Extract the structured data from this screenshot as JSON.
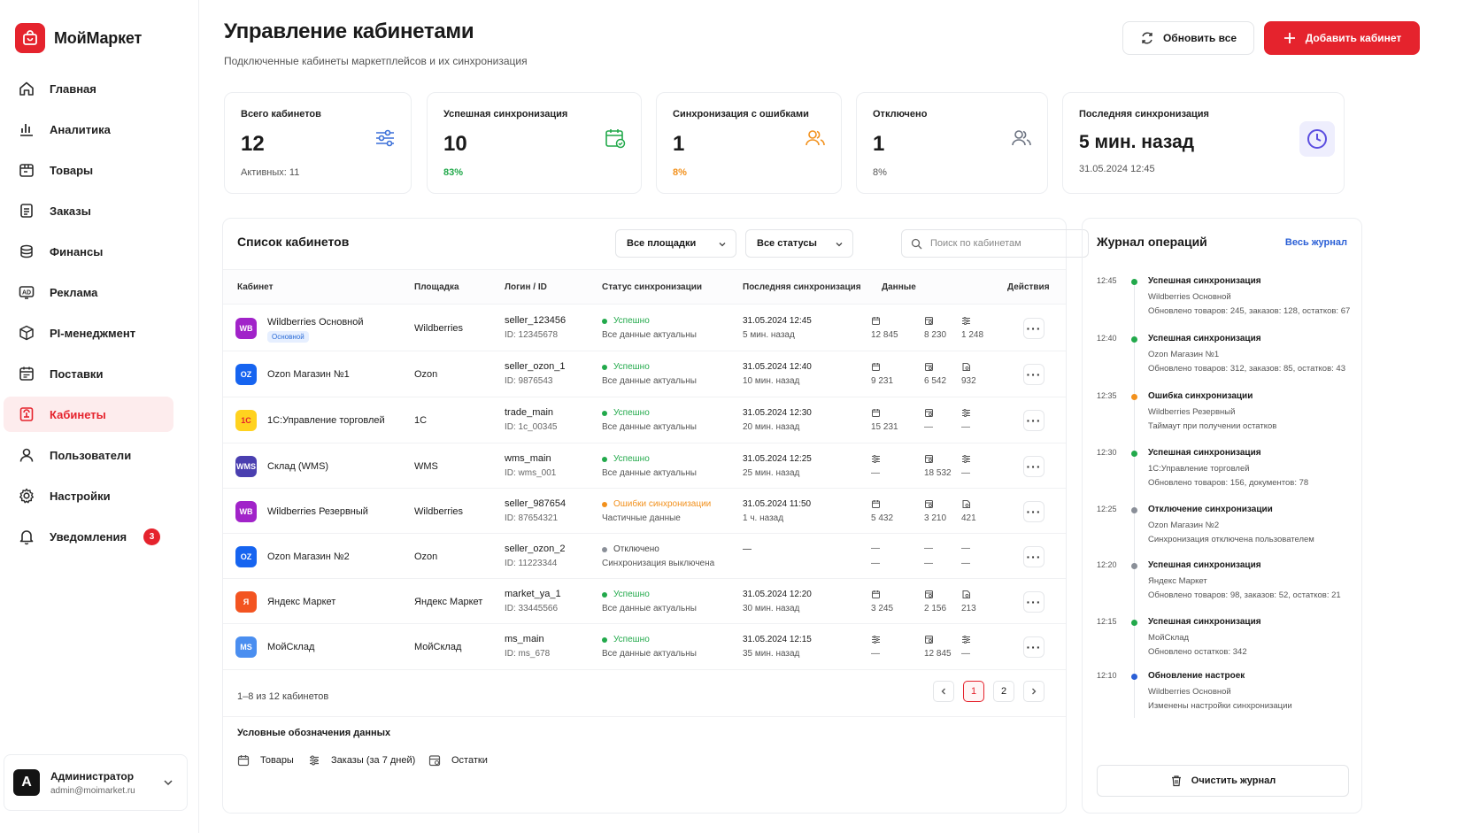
{
  "app": {
    "name": "МойМаркет"
  },
  "nav": [
    {
      "label": "Главная",
      "icon": "home-icon"
    },
    {
      "label": "Аналитика",
      "icon": "bar-chart-icon"
    },
    {
      "label": "Товары",
      "icon": "box-icon"
    },
    {
      "label": "Заказы",
      "icon": "clipboard-icon"
    },
    {
      "label": "Финансы",
      "icon": "coins-icon"
    },
    {
      "label": "Реклама",
      "icon": "ad-icon"
    },
    {
      "label": "PI-менеджмент",
      "icon": "cube-icon"
    },
    {
      "label": "Поставки",
      "icon": "calendar-icon"
    },
    {
      "label": "Кабинеты",
      "icon": "cabinet-icon",
      "active": true
    },
    {
      "label": "Пользователи",
      "icon": "user-icon"
    },
    {
      "label": "Настройки",
      "icon": "gear-icon"
    },
    {
      "label": "Уведомления",
      "icon": "bell-icon",
      "badge": "3"
    }
  ],
  "user": {
    "initial": "A",
    "name": "Администратор",
    "email": "admin@moimarket.ru"
  },
  "header": {
    "title": "Управление кабинетами",
    "subtitle": "Подключенные кабинеты маркетплейсов и их синхронизация",
    "refresh_label": "Обновить все",
    "add_label": "Добавить кабинет"
  },
  "stats": [
    {
      "label": "Всего кабинетов",
      "value": "12",
      "sub": "Активных: 11",
      "icon": "sliders-icon"
    },
    {
      "label": "Успешная синхронизация",
      "value": "10",
      "sub": "83%",
      "icon": "calendar-check-icon"
    },
    {
      "label": "Синхронизация с ошибками",
      "value": "1",
      "sub": "8%",
      "icon": "users-icon"
    },
    {
      "label": "Отключено",
      "value": "1",
      "sub": "8%",
      "icon": "users-icon"
    },
    {
      "label": "Последняя синхронизация",
      "value": "5 мин. назад",
      "sub": "31.05.2024 12:45",
      "icon": "clock-icon"
    }
  ],
  "list": {
    "title": "Список кабинетов",
    "filter_platform": "Все площадки",
    "filter_status": "Все статусы",
    "search_placeholder": "Поиск по кабинетам",
    "columns": [
      "Кабинет",
      "Площадка",
      "Логин / ID",
      "Статус синхронизации",
      "Последняя синхронизация",
      "Данные",
      "Действия"
    ],
    "rows": [
      {
        "logo": "WB",
        "name": "Wildberries Основной",
        "tag": "Основной",
        "platform": "Wildberries",
        "login": "seller_123456",
        "id": "ID: 12345678",
        "status": "Успешно",
        "status_desc": "Все данные актуальны",
        "date": "31.05.2024 12:45",
        "ago": "5 мин. назад",
        "d": [
          "12 845",
          "8 230",
          "1 248"
        ],
        "di": [
          "calendar",
          "box",
          "list"
        ]
      },
      {
        "logo": "OZ",
        "name": "Ozon Магазин №1",
        "tag": "",
        "platform": "Ozon",
        "login": "seller_ozon_1",
        "id": "ID: 9876543",
        "status": "Успешно",
        "status_desc": "Все данные актуальны",
        "date": "31.05.2024 12:40",
        "ago": "10 мин. назад",
        "d": [
          "9 231",
          "6 542",
          "932"
        ],
        "di": [
          "calendar",
          "box",
          "doc"
        ]
      },
      {
        "logo": "1С",
        "name": "1С:Управление торговлей",
        "tag": "",
        "platform": "1С",
        "login": "trade_main",
        "id": "ID: 1c_00345",
        "status": "Успешно",
        "status_desc": "Все данные актуальны",
        "date": "31.05.2024 12:30",
        "ago": "20 мин. назад",
        "d": [
          "15 231",
          "—",
          "—"
        ],
        "di": [
          "calendar",
          "box",
          "list"
        ]
      },
      {
        "logo": "WMS",
        "name": "Склад (WMS)",
        "tag": "",
        "platform": "WMS",
        "login": "wms_main",
        "id": "ID: wms_001",
        "status": "Успешно",
        "status_desc": "Все данные актуальны",
        "date": "31.05.2024 12:25",
        "ago": "25 мин. назад",
        "d": [
          "—",
          "18 532",
          "—"
        ],
        "di": [
          "list",
          "box",
          "list"
        ]
      },
      {
        "logo": "WB",
        "name": "Wildberries Резервный",
        "tag": "",
        "platform": "Wildberries",
        "login": "seller_987654",
        "id": "ID: 87654321",
        "status": "Ошибки синхронизации",
        "status_desc": "Частичные данные",
        "date": "31.05.2024 11:50",
        "ago": "1 ч. назад",
        "d": [
          "5 432",
          "3 210",
          "421"
        ],
        "di": [
          "calendar",
          "box",
          "doc"
        ]
      },
      {
        "logo": "OZ",
        "name": "Ozon Магазин №2",
        "tag": "",
        "platform": "Ozon",
        "login": "seller_ozon_2",
        "id": "ID: 11223344",
        "status": "Отключено",
        "status_desc": "Синхронизация выключена",
        "date": "—",
        "ago": "",
        "d": [
          "—",
          "—",
          "—"
        ],
        "di": [
          "",
          "",
          ""
        ]
      },
      {
        "logo": "Я",
        "name": "Яндекс Маркет",
        "tag": "",
        "platform": "Яндекс Маркет",
        "login": "market_ya_1",
        "id": "ID: 33445566",
        "status": "Успешно",
        "status_desc": "Все данные актуальны",
        "date": "31.05.2024 12:20",
        "ago": "30 мин. назад",
        "d": [
          "3 245",
          "2 156",
          "213"
        ],
        "di": [
          "calendar",
          "box",
          "doc"
        ]
      },
      {
        "logo": "MS",
        "name": "МойСклад",
        "tag": "",
        "platform": "МойСклад",
        "login": "ms_main",
        "id": "ID: ms_678",
        "status": "Успешно",
        "status_desc": "Все данные актуальны",
        "date": "31.05.2024 12:15",
        "ago": "35 мин. назад",
        "d": [
          "—",
          "12 845",
          "—"
        ],
        "di": [
          "list",
          "box",
          "list"
        ]
      }
    ],
    "pagination_text": "1–8 из 12 кабинетов",
    "pages": [
      "1",
      "2"
    ],
    "current_page": "1"
  },
  "legend": {
    "title": "Условные обозначения данных",
    "items": [
      "Товары",
      "Заказы (за 7 дней)",
      "Остатки"
    ]
  },
  "journal": {
    "title": "Журнал операций",
    "link": "Весь журнал",
    "events": [
      {
        "time": "12:45",
        "title": "Успешная синхронизация",
        "source": "Wildberries Основной",
        "detail": "Обновлено товаров: 245, заказов: 128, остатков: 67",
        "kind": "success"
      },
      {
        "time": "12:40",
        "title": "Успешная синхронизация",
        "source": "Ozon Магазин №1",
        "detail": "Обновлено товаров: 312, заказов: 85, остатков: 43",
        "kind": "success"
      },
      {
        "time": "12:35",
        "title": "Ошибка синхронизации",
        "source": "Wildberries Резервный",
        "detail": "Таймаут при получении остатков",
        "kind": "error"
      },
      {
        "time": "12:30",
        "title": "Успешная синхронизация",
        "source": "1С:Управление торговлей",
        "detail": "Обновлено товаров: 156, документов: 78",
        "kind": "success"
      },
      {
        "time": "12:25",
        "title": "Отключение синхронизации",
        "source": "Ozon Магазин №2",
        "detail": "Синхронизация отключена пользователем",
        "kind": "off"
      },
      {
        "time": "12:20",
        "title": "Успешная синхронизация",
        "source": "Яндекс Маркет",
        "detail": "Обновлено товаров: 98, заказов: 52, остатков: 21",
        "kind": "off"
      },
      {
        "time": "12:15",
        "title": "Успешная синхронизация",
        "source": "МойСклад",
        "detail": "Обновлено остатков: 342",
        "kind": "success"
      },
      {
        "time": "12:10",
        "title": "Обновление настроек",
        "source": "Wildberries Основной",
        "detail": "Изменены настройки синхронизации",
        "kind": "info"
      }
    ],
    "clear_label": "Очистить журнал"
  },
  "colors": {
    "accent": "#e5232d",
    "success": "#22a94b",
    "warning": "#f2911d",
    "muted": "#8a8f98",
    "info": "#2a5fd6"
  }
}
